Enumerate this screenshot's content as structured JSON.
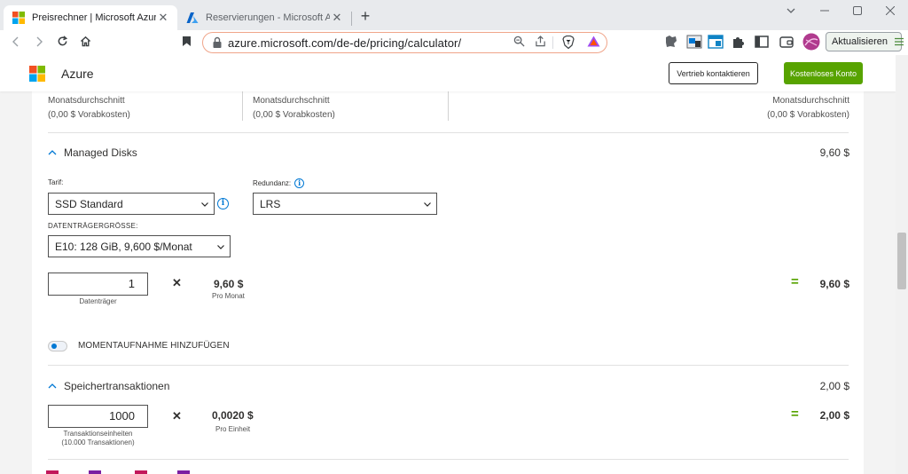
{
  "browser": {
    "tabs": [
      {
        "title": "Preisrechner | Microsoft Azure",
        "active": true
      },
      {
        "title": "Reservierungen - Microsoft Azure",
        "active": false
      }
    ],
    "close_symbol": "✕",
    "new_tab_symbol": "+",
    "url": "azure.microsoft.com/de-de/pricing/calculator/",
    "update_button": "Aktualisieren",
    "icons": [
      "back-icon",
      "forward-icon",
      "reload-icon",
      "home-icon",
      "bookmark-icon",
      "lock-icon",
      "search-icon",
      "share-icon",
      "brave-shield-icon",
      "brave-rewards-icon",
      "extension-icons",
      "puzzle-icon",
      "sidebar-icon",
      "wallet-icon",
      "profile-avatar",
      "menu-icon"
    ]
  },
  "header": {
    "brand": "Azure",
    "contact_sales": "Vertrieb kontaktieren",
    "free_account": "Kostenloses Konto"
  },
  "summary": {
    "col1": {
      "label": "Monatsdurchschnitt",
      "upfront": "(0,00 $ Vorabkosten)"
    },
    "col2": {
      "label": "Monatsdurchschnitt",
      "upfront": "(0,00 $ Vorabkosten)"
    },
    "col3": {
      "label": "Monatsdurchschnitt",
      "upfront": "(0,00 $ Vorabkosten)"
    }
  },
  "managed_disks": {
    "title": "Managed Disks",
    "cost": "9,60 $",
    "tier_label": "Tarif:",
    "tier_value": "SSD Standard",
    "redundancy_label": "Redundanz:",
    "redundancy_value": "LRS",
    "disk_size_label": "DATENTRÄGERGRÖSSE:",
    "disk_size_value": "E10: 128 GiB, 9,600 $/Monat",
    "quantity": "1",
    "quantity_caption": "Datenträger",
    "times_symbol": "✕",
    "unit_price": "9,60 $",
    "unit_caption": "Pro Monat",
    "equals_symbol": "=",
    "total": "9,60 $",
    "snapshot_label": "MOMENTAUFNAHME HINZUFÜGEN",
    "snapshot_enabled": false
  },
  "storage_transactions": {
    "title": "Speichertransaktionen",
    "cost": "2,00 $",
    "quantity": "1000",
    "quantity_caption_1": "Transaktionseinheiten",
    "quantity_caption_2": "(10.000 Transaktionen)",
    "times_symbol": "✕",
    "unit_price": "0,0020 $",
    "unit_caption": "Pro Einheit",
    "equals_symbol": "=",
    "total": "2,00 $"
  },
  "colors": {
    "accent_green": "#57a300",
    "link_blue": "#0078d4",
    "omnibox_border": "#f0a58a"
  }
}
